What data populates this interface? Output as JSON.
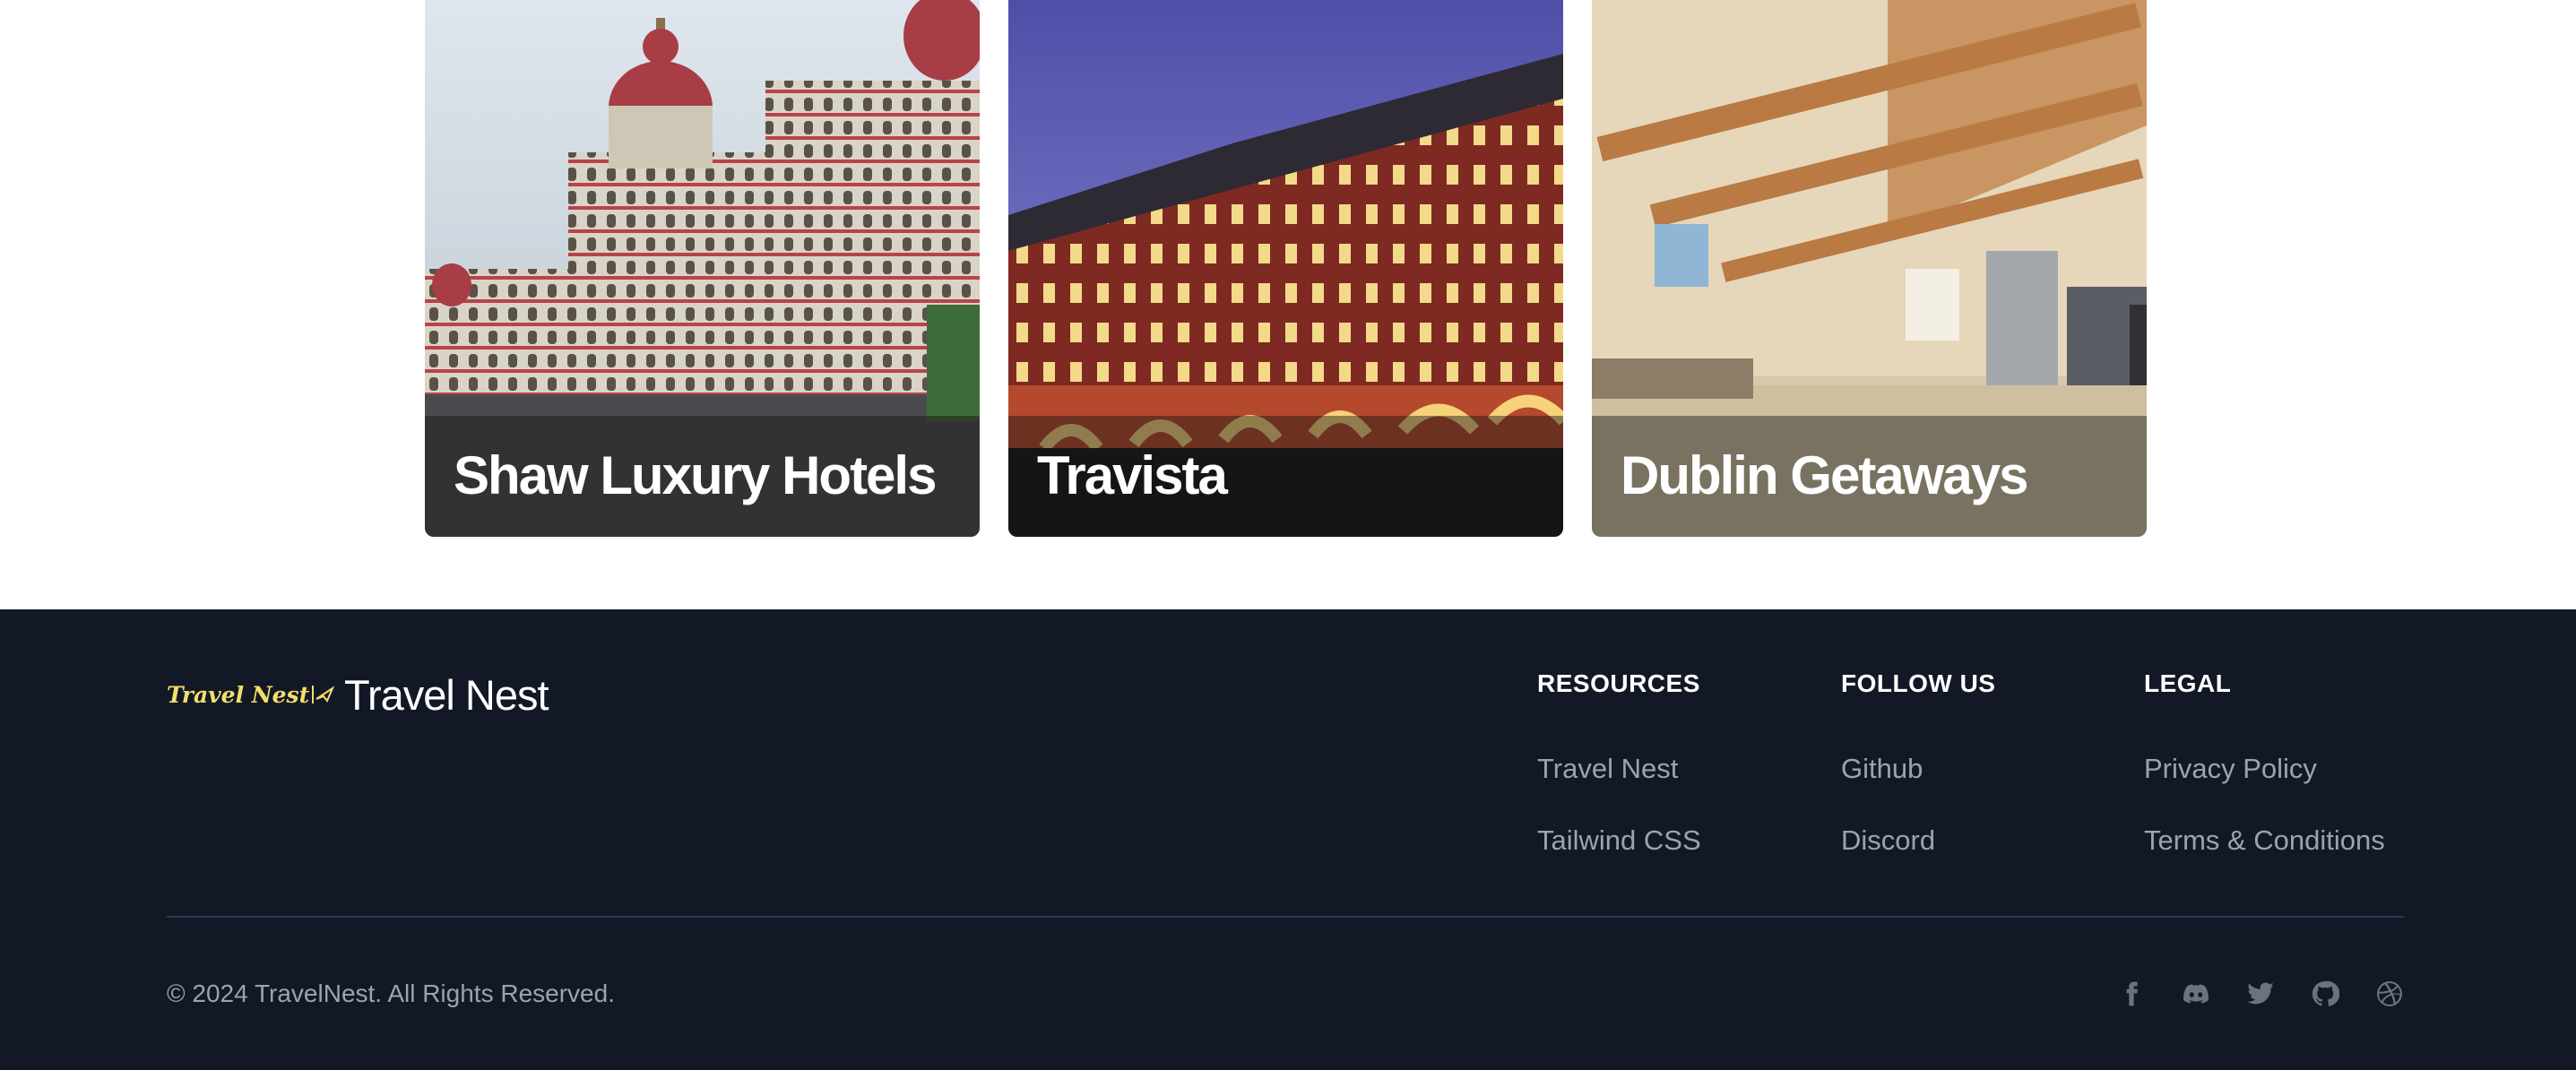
{
  "cards": [
    {
      "name": "Shaw Luxury Hotels"
    },
    {
      "name": "Travista"
    },
    {
      "name": "Dublin Getaways"
    }
  ],
  "footer": {
    "logo_text": "Travel Nest",
    "brand": "Travel Nest",
    "columns": [
      {
        "title": "RESOURCES",
        "links": [
          "Travel Nest",
          "Tailwind CSS"
        ]
      },
      {
        "title": "FOLLOW US",
        "links": [
          "Github",
          "Discord"
        ]
      },
      {
        "title": "LEGAL",
        "links": [
          "Privacy Policy",
          "Terms & Conditions"
        ]
      }
    ],
    "copyright": "© 2024 TravelNest. All Rights Reserved.",
    "social_icons": [
      "facebook-icon",
      "discord-icon",
      "twitter-icon",
      "github-icon",
      "dribbble-icon"
    ]
  },
  "colors": {
    "footer_bg": "#131826",
    "link": "#9ca3af",
    "logo_yellow": "#f2df6a"
  }
}
